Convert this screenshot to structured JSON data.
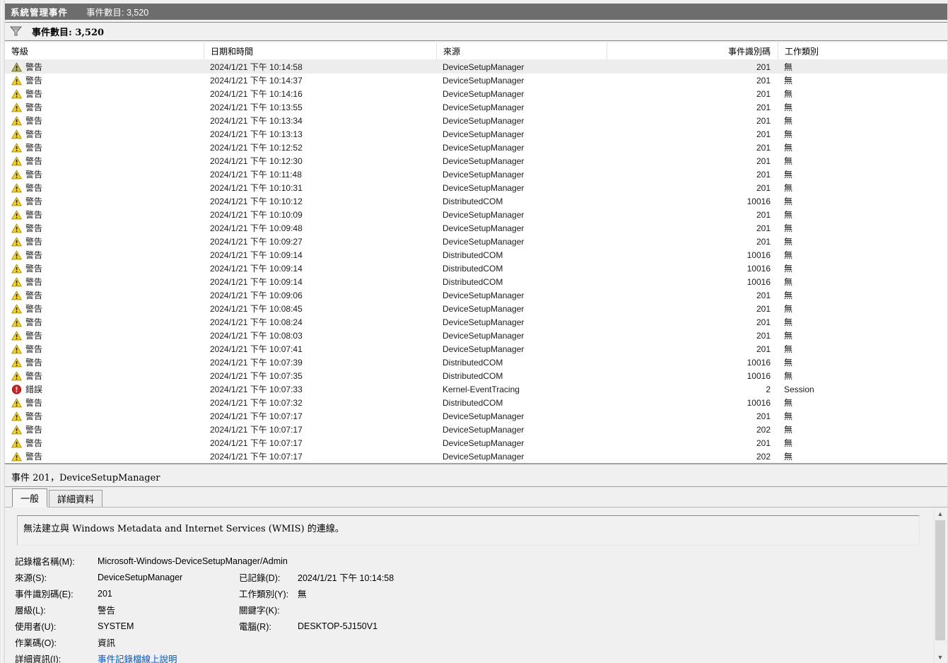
{
  "window": {
    "title": "系統管理事件",
    "event_count": "事件數目: 3,520"
  },
  "filter_bar": {
    "icon": "filter-funnel-icon",
    "label": "事件數目: 3,520"
  },
  "table": {
    "columns": [
      "等級",
      "日期和時間",
      "來源",
      "事件識別碼",
      "工作類別"
    ],
    "rows": [
      {
        "icon": "warning-icon",
        "level": "警告",
        "selected": true,
        "datetime": "2024/1/21 下午 10:14:58",
        "source": "DeviceSetupManager",
        "event_id": "201",
        "task_category": "無"
      },
      {
        "icon": "warning-icon",
        "level": "警告",
        "selected": false,
        "datetime": "2024/1/21 下午 10:14:37",
        "source": "DeviceSetupManager",
        "event_id": "201",
        "task_category": "無"
      },
      {
        "icon": "warning-icon",
        "level": "警告",
        "selected": false,
        "datetime": "2024/1/21 下午 10:14:16",
        "source": "DeviceSetupManager",
        "event_id": "201",
        "task_category": "無"
      },
      {
        "icon": "warning-icon",
        "level": "警告",
        "selected": false,
        "datetime": "2024/1/21 下午 10:13:55",
        "source": "DeviceSetupManager",
        "event_id": "201",
        "task_category": "無"
      },
      {
        "icon": "warning-icon",
        "level": "警告",
        "selected": false,
        "datetime": "2024/1/21 下午 10:13:34",
        "source": "DeviceSetupManager",
        "event_id": "201",
        "task_category": "無"
      },
      {
        "icon": "warning-icon",
        "level": "警告",
        "selected": false,
        "datetime": "2024/1/21 下午 10:13:13",
        "source": "DeviceSetupManager",
        "event_id": "201",
        "task_category": "無"
      },
      {
        "icon": "warning-icon",
        "level": "警告",
        "selected": false,
        "datetime": "2024/1/21 下午 10:12:52",
        "source": "DeviceSetupManager",
        "event_id": "201",
        "task_category": "無"
      },
      {
        "icon": "warning-icon",
        "level": "警告",
        "selected": false,
        "datetime": "2024/1/21 下午 10:12:30",
        "source": "DeviceSetupManager",
        "event_id": "201",
        "task_category": "無"
      },
      {
        "icon": "warning-icon",
        "level": "警告",
        "selected": false,
        "datetime": "2024/1/21 下午 10:11:48",
        "source": "DeviceSetupManager",
        "event_id": "201",
        "task_category": "無"
      },
      {
        "icon": "warning-icon",
        "level": "警告",
        "selected": false,
        "datetime": "2024/1/21 下午 10:10:31",
        "source": "DeviceSetupManager",
        "event_id": "201",
        "task_category": "無"
      },
      {
        "icon": "warning-icon",
        "level": "警告",
        "selected": false,
        "datetime": "2024/1/21 下午 10:10:12",
        "source": "DistributedCOM",
        "event_id": "10016",
        "task_category": "無"
      },
      {
        "icon": "warning-icon",
        "level": "警告",
        "selected": false,
        "datetime": "2024/1/21 下午 10:10:09",
        "source": "DeviceSetupManager",
        "event_id": "201",
        "task_category": "無"
      },
      {
        "icon": "warning-icon",
        "level": "警告",
        "selected": false,
        "datetime": "2024/1/21 下午 10:09:48",
        "source": "DeviceSetupManager",
        "event_id": "201",
        "task_category": "無"
      },
      {
        "icon": "warning-icon",
        "level": "警告",
        "selected": false,
        "datetime": "2024/1/21 下午 10:09:27",
        "source": "DeviceSetupManager",
        "event_id": "201",
        "task_category": "無"
      },
      {
        "icon": "warning-icon",
        "level": "警告",
        "selected": false,
        "datetime": "2024/1/21 下午 10:09:14",
        "source": "DistributedCOM",
        "event_id": "10016",
        "task_category": "無"
      },
      {
        "icon": "warning-icon",
        "level": "警告",
        "selected": false,
        "datetime": "2024/1/21 下午 10:09:14",
        "source": "DistributedCOM",
        "event_id": "10016",
        "task_category": "無"
      },
      {
        "icon": "warning-icon",
        "level": "警告",
        "selected": false,
        "datetime": "2024/1/21 下午 10:09:14",
        "source": "DistributedCOM",
        "event_id": "10016",
        "task_category": "無"
      },
      {
        "icon": "warning-icon",
        "level": "警告",
        "selected": false,
        "datetime": "2024/1/21 下午 10:09:06",
        "source": "DeviceSetupManager",
        "event_id": "201",
        "task_category": "無"
      },
      {
        "icon": "warning-icon",
        "level": "警告",
        "selected": false,
        "datetime": "2024/1/21 下午 10:08:45",
        "source": "DeviceSetupManager",
        "event_id": "201",
        "task_category": "無"
      },
      {
        "icon": "warning-icon",
        "level": "警告",
        "selected": false,
        "datetime": "2024/1/21 下午 10:08:24",
        "source": "DeviceSetupManager",
        "event_id": "201",
        "task_category": "無"
      },
      {
        "icon": "warning-icon",
        "level": "警告",
        "selected": false,
        "datetime": "2024/1/21 下午 10:08:03",
        "source": "DeviceSetupManager",
        "event_id": "201",
        "task_category": "無"
      },
      {
        "icon": "warning-icon",
        "level": "警告",
        "selected": false,
        "datetime": "2024/1/21 下午 10:07:41",
        "source": "DeviceSetupManager",
        "event_id": "201",
        "task_category": "無"
      },
      {
        "icon": "warning-icon",
        "level": "警告",
        "selected": false,
        "datetime": "2024/1/21 下午 10:07:39",
        "source": "DistributedCOM",
        "event_id": "10016",
        "task_category": "無"
      },
      {
        "icon": "warning-icon",
        "level": "警告",
        "selected": false,
        "datetime": "2024/1/21 下午 10:07:35",
        "source": "DistributedCOM",
        "event_id": "10016",
        "task_category": "無"
      },
      {
        "icon": "error-icon",
        "level": "錯誤",
        "selected": false,
        "datetime": "2024/1/21 下午 10:07:33",
        "source": "Kernel-EventTracing",
        "event_id": "2",
        "task_category": "Session"
      },
      {
        "icon": "warning-icon",
        "level": "警告",
        "selected": false,
        "datetime": "2024/1/21 下午 10:07:32",
        "source": "DistributedCOM",
        "event_id": "10016",
        "task_category": "無"
      },
      {
        "icon": "warning-icon",
        "level": "警告",
        "selected": false,
        "datetime": "2024/1/21 下午 10:07:17",
        "source": "DeviceSetupManager",
        "event_id": "201",
        "task_category": "無"
      },
      {
        "icon": "warning-icon",
        "level": "警告",
        "selected": false,
        "datetime": "2024/1/21 下午 10:07:17",
        "source": "DeviceSetupManager",
        "event_id": "202",
        "task_category": "無"
      },
      {
        "icon": "warning-icon",
        "level": "警告",
        "selected": false,
        "datetime": "2024/1/21 下午 10:07:17",
        "source": "DeviceSetupManager",
        "event_id": "201",
        "task_category": "無"
      },
      {
        "icon": "warning-icon",
        "level": "警告",
        "selected": false,
        "datetime": "2024/1/21 下午 10:07:17",
        "source": "DeviceSetupManager",
        "event_id": "202",
        "task_category": "無"
      }
    ]
  },
  "detail": {
    "header": "事件 201，DeviceSetupManager",
    "tabs": [
      "一般",
      "詳細資料"
    ],
    "active_tab": "一般",
    "description": "無法建立與 Windows Metadata and Internet Services (WMIS) 的連線。",
    "fields": [
      {
        "label": "記錄檔名稱(M):",
        "value": "Microsoft-Windows-DeviceSetupManager/Admin",
        "label2": "",
        "value2": "",
        "wide": true,
        "link": false
      },
      {
        "label": "來源(S):",
        "value": "DeviceSetupManager",
        "label2": "已記錄(D):",
        "value2": "2024/1/21 下午 10:14:58",
        "wide": false,
        "link": false
      },
      {
        "label": "事件識別碼(E):",
        "value": "201",
        "label2": "工作類別(Y):",
        "value2": "無",
        "wide": false,
        "link": false
      },
      {
        "label": "層級(L):",
        "value": "警告",
        "label2": "關鍵字(K):",
        "value2": "",
        "wide": false,
        "link": false
      },
      {
        "label": "使用者(U):",
        "value": "SYSTEM",
        "label2": "電腦(R):",
        "value2": "DESKTOP-5J150V1",
        "wide": false,
        "link": false
      },
      {
        "label": "作業碼(O):",
        "value": "資訊",
        "label2": "",
        "value2": "",
        "wide": false,
        "link": false
      },
      {
        "label": "詳細資訊(I):",
        "value": "事件記錄檔線上說明",
        "label2": "",
        "value2": "",
        "wide": true,
        "link": true
      }
    ]
  },
  "colors": {
    "titlebar_bg": "#6d6d6d",
    "warning_yellow": "#fcd60a",
    "warning_selected_olive": "#b9b952",
    "error_red": "#ce2121",
    "link_blue": "#0757c4",
    "selected_row_bg": "#ededed"
  }
}
